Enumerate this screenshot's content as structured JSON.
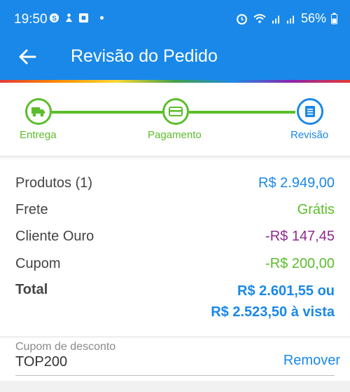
{
  "status_bar": {
    "time": "19:50",
    "battery": "56%",
    "icons": [
      "s-app-icon",
      "notification-icon",
      "app-icon",
      "dot-icon",
      "alarm-icon",
      "wifi-icon",
      "signal-icon",
      "signal-icon",
      "battery-icon"
    ]
  },
  "app_bar": {
    "title": "Revisão do Pedido",
    "back_icon": "arrow-left-icon"
  },
  "colors": {
    "primary": "#1a88e8",
    "success": "#5bbd2a",
    "purple": "#8e2a8e"
  },
  "stepper": {
    "steps": [
      {
        "label": "Entrega",
        "icon": "truck-icon",
        "state": "done"
      },
      {
        "label": "Pagamento",
        "icon": "card-icon",
        "state": "done"
      },
      {
        "label": "Revisão",
        "icon": "list-icon",
        "state": "current"
      }
    ]
  },
  "summary": {
    "products_label": "Produtos (1)",
    "products_value": "R$ 2.949,00",
    "shipping_label": "Frete",
    "shipping_value": "Grátis",
    "gold_label": "Cliente Ouro",
    "gold_value": "-R$ 147,45",
    "coupon_label": "Cupom",
    "coupon_value": "-R$ 200,00",
    "total_label": "Total",
    "total_value_line1": "R$ 2.601,55 ou",
    "total_value_line2": "R$ 2.523,50 à vista"
  },
  "coupon": {
    "field_label": "Cupom de desconto",
    "field_value": "TOP200",
    "remove_label": "Remover"
  }
}
